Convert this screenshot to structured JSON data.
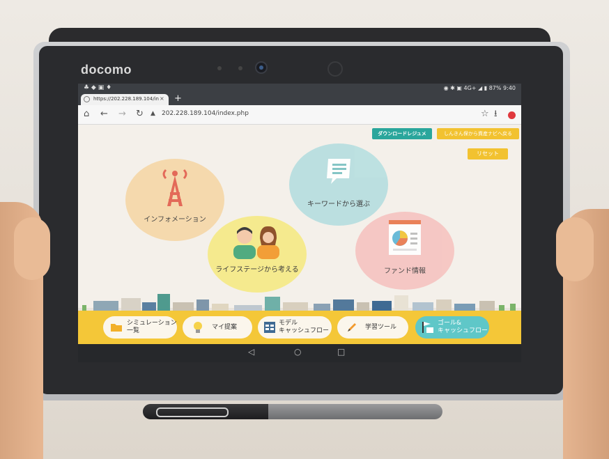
{
  "device": {
    "brand": "docomo"
  },
  "status_bar": {
    "time": "9:40",
    "battery": "87%",
    "network": "4G+"
  },
  "browser": {
    "tab_title": "https://202.228.189.104/in",
    "url": "202.228.189.104/index.php",
    "new_tab": "+",
    "tab_close": "×"
  },
  "page": {
    "download_button": "ダウンロードレジュメ",
    "navi_button": "しんきん保から資産ナビへ戻る",
    "reset_button": "リセット",
    "bubbles": {
      "information": "インフォメーション",
      "keyword": "キーワードから選ぶ",
      "lifestage": "ライフステージから考える",
      "fund": "ファンド情報"
    },
    "nav": {
      "simulation": "シミュレーション\n一覧",
      "my_proposal": "マイ提案",
      "model_cashflow": "モデル\nキャッシュフロー",
      "learning_tool": "学習ツール",
      "goal_cashflow": "ゴール&\nキャッシュフロー"
    }
  },
  "colors": {
    "nav_bar": "#f4c738",
    "download_button": "#2aa69c",
    "yellow_button": "#f2c230",
    "active_nav": "#5fc7c8"
  }
}
